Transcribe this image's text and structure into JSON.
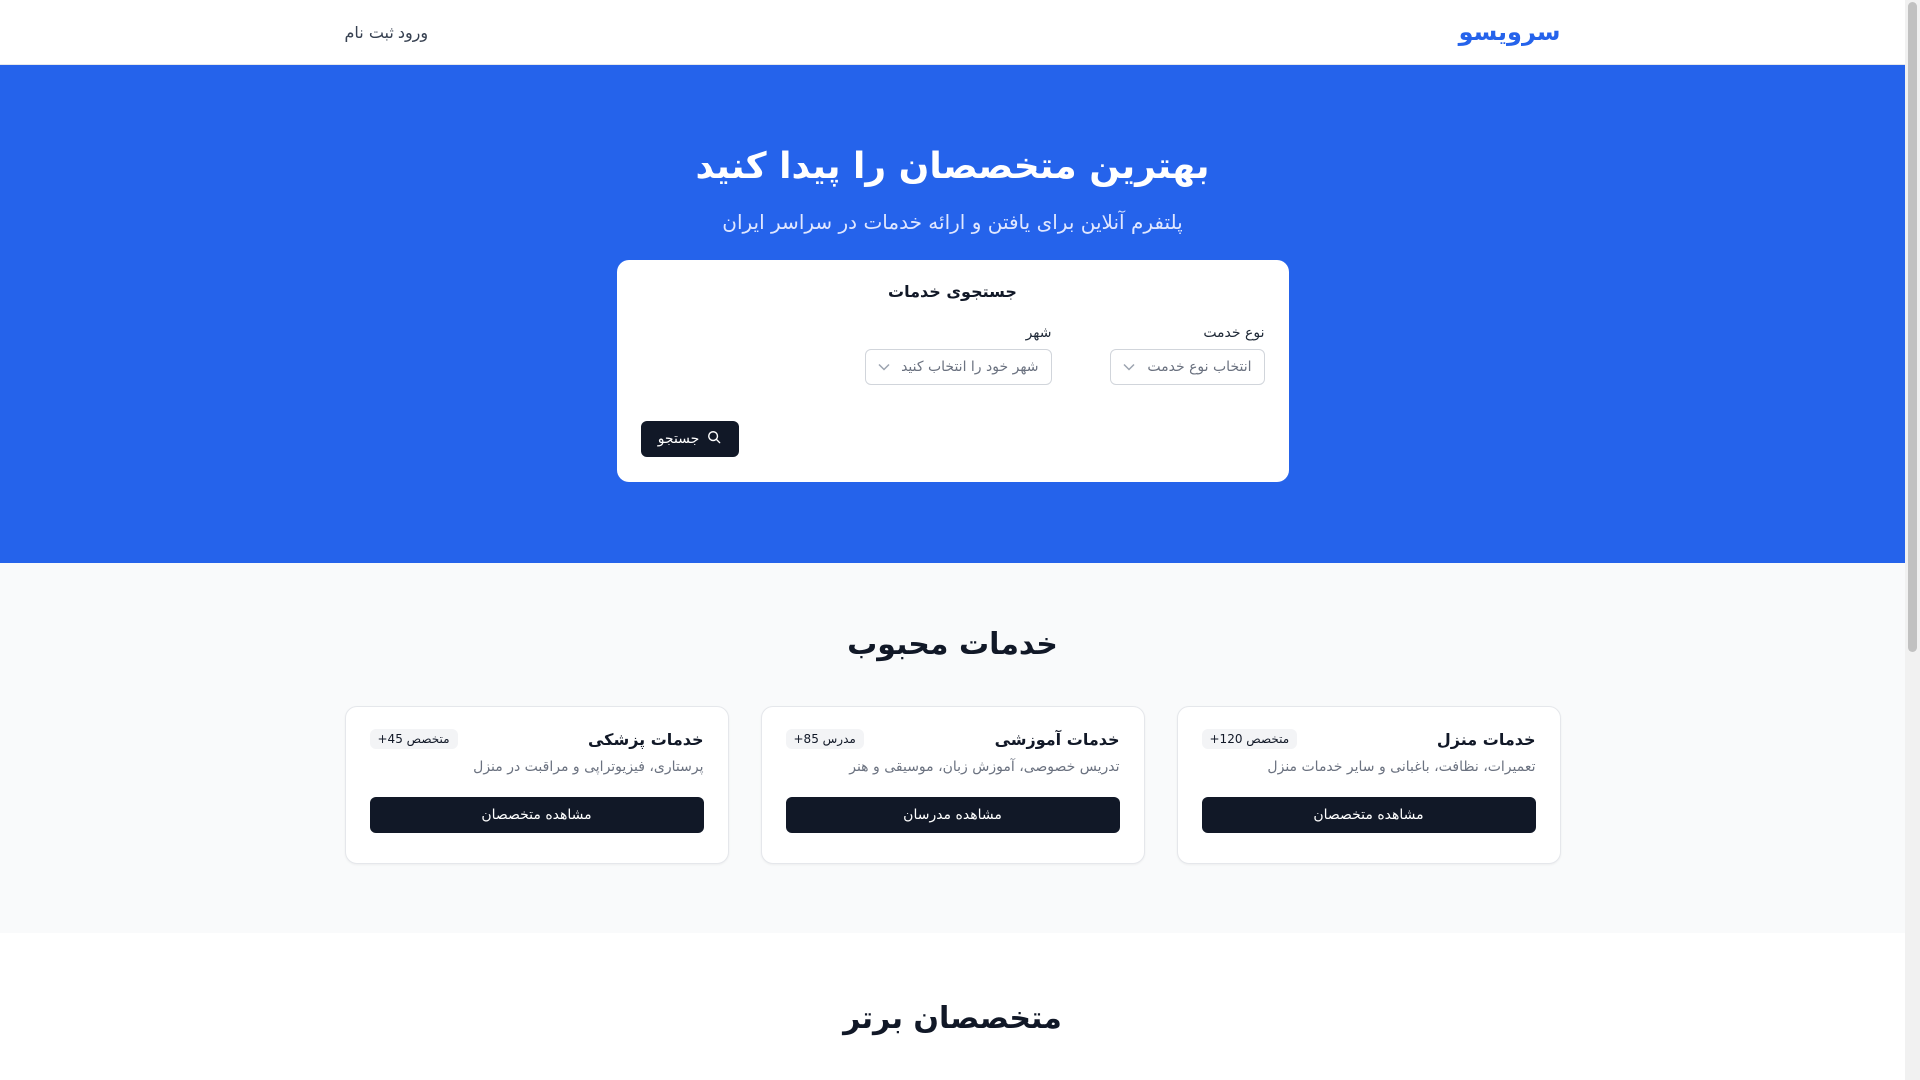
{
  "header": {
    "logo": "سرویسو",
    "nav_login": "ورود",
    "nav_register": "ثبت نام"
  },
  "hero": {
    "title": "بهترین متخصصان را پیدا کنید",
    "subtitle": "پلتفرم آنلاین برای یافتن و ارائه خدمات در سراسر ایران"
  },
  "search": {
    "title": "جستجوی خدمات",
    "service_type_label": "نوع خدمت",
    "service_type_value": "انتخاب نوع خدمت",
    "city_label": "شهر",
    "city_value": "شهر خود را انتخاب کنید",
    "button_label": "جستجو",
    "button_icon": "search-icon"
  },
  "popular": {
    "title": "خدمات محبوب",
    "cards": [
      {
        "title": "خدمات منزل",
        "badge": "+120 متخصص",
        "description": "تعمیرات، نظافت، باغبانی و سایر خدمات منزل",
        "button": "مشاهده متخصصان"
      },
      {
        "title": "خدمات آموزشی",
        "badge": "+85 مدرس",
        "description": "تدریس خصوصی، آموزش زبان، موسیقی و هنر",
        "button": "مشاهده مدرسان"
      },
      {
        "title": "خدمات پزشکی",
        "badge": "+45 متخصص",
        "description": "پرستاری، فیزیوتراپی و مراقبت در منزل",
        "button": "مشاهده متخصصان"
      }
    ]
  },
  "top_experts": {
    "title": "متخصصان برتر"
  },
  "colors": {
    "primary": "#2563eb",
    "dark": "#111827",
    "muted": "#6b7280"
  }
}
